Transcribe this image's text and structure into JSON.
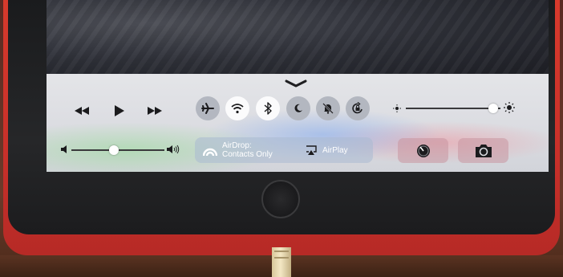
{
  "control_center": {
    "media": {
      "rewind_icon": "rewind-icon",
      "play_icon": "play-icon",
      "fast_forward_icon": "fast-forward-icon",
      "volume_level": 0.45
    },
    "toggles": [
      {
        "icon": "airplane-icon",
        "on": false
      },
      {
        "icon": "wifi-icon",
        "on": true
      },
      {
        "icon": "bluetooth-icon",
        "on": true
      },
      {
        "icon": "moon-icon",
        "on": false
      },
      {
        "icon": "mute-icon",
        "on": false
      },
      {
        "icon": "rotation-lock-icon",
        "on": false
      }
    ],
    "brightness_level": 0.97,
    "airdrop": {
      "title": "AirDrop:",
      "subtitle": "Contacts Only"
    },
    "airplay": {
      "label": "AirPlay"
    },
    "quick_actions": [
      {
        "icon": "timer-icon"
      },
      {
        "icon": "camera-icon"
      }
    ]
  },
  "colors": {
    "panel": "#dcdde2",
    "toggle_off": "#b3b7c0",
    "toggle_on": "#fbfbfc",
    "case": "#c9302a"
  }
}
